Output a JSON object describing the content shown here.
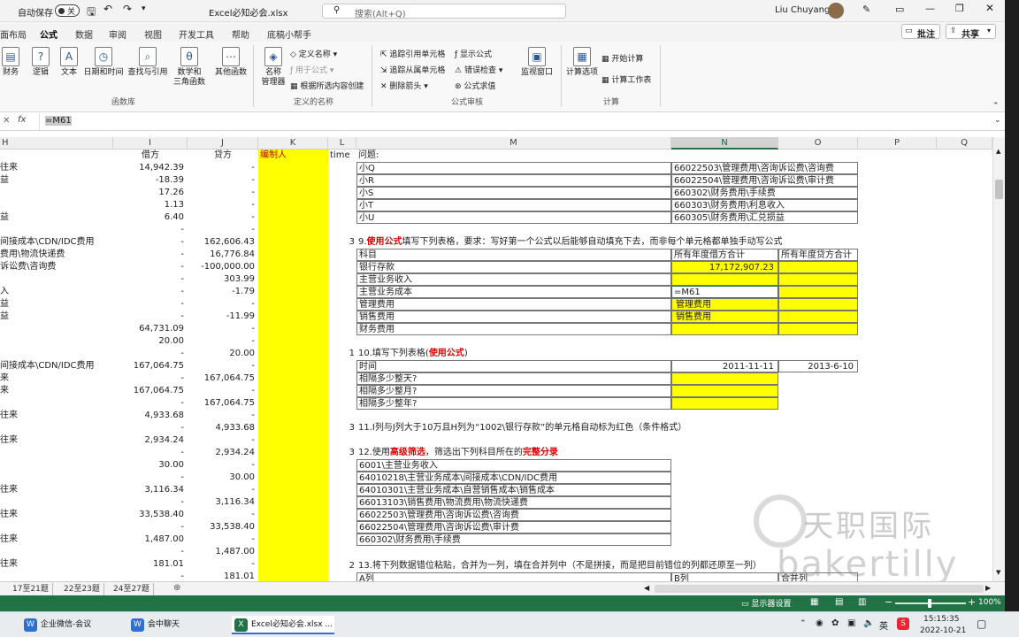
{
  "title": {
    "autosave": "自动保存",
    "toggle": "关",
    "filename": "Excel必知必会.xlsx",
    "search_placeholder": "搜索(Alt+Q)",
    "user": "Liu Chuyang",
    "comment": "批注",
    "share": "共享"
  },
  "tabs": [
    "面布局",
    "公式",
    "数据",
    "审阅",
    "视图",
    "开发工具",
    "帮助",
    "底稿小帮手"
  ],
  "ribbon": {
    "lib": {
      "btns": [
        "财务",
        "逻辑",
        "文本",
        "日期和时间",
        "查找与引用",
        "数学和\n三角函数",
        "其他函数"
      ],
      "label": "函数库"
    },
    "names": {
      "manager": "名称\n管理器",
      "define": "定义名称",
      "use": "用于公式",
      "create": "根据所选内容创建",
      "label": "定义的名称"
    },
    "audit": {
      "trace_prec": "追踪引用单元格",
      "trace_dep": "追踪从属单元格",
      "remove": "删除箭头",
      "show": "显示公式",
      "error": "错误检查",
      "eval": "公式求值",
      "watch": "监视窗口",
      "label": "公式审核"
    },
    "calc": {
      "options": "计算选项",
      "now": "开始计算",
      "sheet": "计算工作表",
      "label": "计算"
    }
  },
  "formula": {
    "fx": "fx",
    "value": "=M61"
  },
  "columns": [
    "H",
    "I",
    "J",
    "K",
    "L",
    "M",
    "N",
    "O",
    "P",
    "Q"
  ],
  "H": [
    "往来",
    "益",
    "",
    "",
    "益",
    "",
    "间接成本\\CDN/IDC费用",
    "费用\\物流快递费",
    "诉讼费\\咨询费",
    "",
    "入",
    "益",
    "益",
    "",
    "",
    "",
    "间接成本\\CDN/IDC费用",
    "来",
    "来",
    "",
    "往来",
    "",
    "往来",
    "",
    "",
    "",
    "往来",
    "",
    "往来",
    "",
    "往来",
    "",
    "往来"
  ],
  "I": [
    "借方",
    "14,942.39",
    "-18.39",
    "17.26",
    "1.13",
    "6.40",
    "-",
    "-",
    "-",
    "-",
    "-",
    "-",
    "-",
    "-",
    "64,731.09",
    "20.00",
    "-",
    "167,064.75",
    "-",
    "167,064.75",
    "-",
    "4,933.68",
    "-",
    "2,934.24",
    "-",
    "30.00",
    "-",
    "3,116.34",
    "-",
    "33,538.40",
    "-",
    "1,487.00",
    "-",
    "181.01",
    "-"
  ],
  "J": [
    "贷方",
    "-",
    "-",
    "-",
    "-",
    "-",
    "-",
    "162,606.43",
    "16,776.84",
    "-100,000.00",
    "303.99",
    "-1.79",
    "-",
    "-11.99",
    "-",
    "-",
    "20.00",
    "-",
    "167,064.75",
    "-",
    "167,064.75",
    "-",
    "4,933.68",
    "-",
    "2,934.24",
    "-",
    "30.00",
    "-",
    "3,116.34",
    "-",
    "33,538.40",
    "-",
    "1,487.00",
    "-",
    "181.01"
  ],
  "K0": "编制人",
  "L0": "time",
  "M0": "问题:",
  "qlist": [
    {
      "m": "小Q",
      "n": "66022503\\管理费用\\咨询诉讼费\\咨询费"
    },
    {
      "m": "小R",
      "n": "66022504\\管理费用\\咨询诉讼费\\审计费"
    },
    {
      "m": "小S",
      "n": "660302\\财务费用\\手续费"
    },
    {
      "m": "小T",
      "n": "660303\\财务费用\\利息收入"
    },
    {
      "m": "小U",
      "n": "660305\\财务费用\\汇兑损益"
    }
  ],
  "q9": {
    "num": "3",
    "pre": "9.",
    "red": "使用公式",
    "post": "填写下列表格，要求：写好第一个公式以后能够自动填充下去，而非每个单元格都单独手动写公式"
  },
  "t9": {
    "h": [
      "科目",
      "所有年度借方合计",
      "所有年度贷方合计"
    ],
    "rows": [
      "银行存款",
      "主营业务收入",
      "主营业务成本",
      "管理费用",
      "销售费用",
      "财务费用"
    ],
    "n": [
      "17,172,907.23",
      "",
      "=M61",
      "管理费用",
      "销售费用",
      ""
    ]
  },
  "q10": {
    "num": "1",
    "pre": "10.填写下列表格(",
    "red": "使用公式",
    "post": ")"
  },
  "t10": {
    "rows": [
      "时间",
      "相隔多少整天?",
      "相隔多少整月?",
      "相隔多少整年?"
    ],
    "d1": "2011-11-11",
    "d2": "2013-6-10"
  },
  "q11": {
    "num": "3",
    "text": "11.I列与J列大于10万且H列为“1002\\银行存款”的单元格自动标为红色（条件格式）"
  },
  "q12": {
    "num": "3",
    "pre": "12.使用",
    "red1": "高级筛选",
    "mid": "，筛选出下列科目所在的",
    "red2": "完整分录"
  },
  "l12": [
    "6001\\主营业务收入",
    "64010218\\主营业务成本\\间接成本\\CDN/IDC费用",
    "64010301\\主营业务成本\\自营销售成本\\销售成本",
    "66013103\\销售费用\\物流费用\\物流快递费",
    "66022503\\管理费用\\咨询诉讼费\\咨询费",
    "66022504\\管理费用\\咨询诉讼费\\审计费",
    "660302\\财务费用\\手续费"
  ],
  "q13": {
    "num": "2",
    "text": "13.将下列数据错位粘贴，合并为一列，填在合并列中（不是拼接，而是把目前错位的列都还原至一列）",
    "a": "A列",
    "b": "B列",
    "merge": "合并列"
  },
  "sheets": [
    "17至21题",
    "22至23题",
    "24至27题"
  ],
  "status": {
    "display": "显示器设置",
    "zoom": "100%"
  },
  "taskbar": {
    "apps": [
      "企业微信-会议",
      "会中聊天",
      "Excel必知必会.xlsx ..."
    ],
    "time": "15:15:35",
    "date": "2022-10-21"
  },
  "watermark": {
    "cn": "天职国际",
    "en": "bakertilly"
  },
  "colors": {
    "excel_green": "#217346",
    "yellow": "#ffff00",
    "red": "#e00000"
  }
}
